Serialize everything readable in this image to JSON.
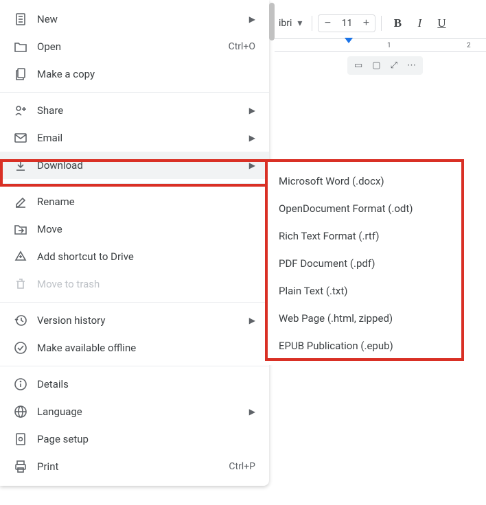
{
  "toolbar": {
    "font_name": "ibri",
    "font_size": "11"
  },
  "ruler": {
    "ticks": [
      "1",
      "2"
    ]
  },
  "menu": {
    "new": "New",
    "open": "Open",
    "open_shortcut": "Ctrl+O",
    "make_copy": "Make a copy",
    "share": "Share",
    "email": "Email",
    "download": "Download",
    "rename": "Rename",
    "move": "Move",
    "add_shortcut": "Add shortcut to Drive",
    "move_trash": "Move to trash",
    "version_history": "Version history",
    "offline": "Make available offline",
    "details": "Details",
    "language": "Language",
    "page_setup": "Page setup",
    "print": "Print",
    "print_shortcut": "Ctrl+P"
  },
  "submenu": {
    "docx": "Microsoft Word (.docx)",
    "odt": "OpenDocument Format (.odt)",
    "rtf": "Rich Text Format (.rtf)",
    "pdf": "PDF Document (.pdf)",
    "txt": "Plain Text (.txt)",
    "html": "Web Page (.html, zipped)",
    "epub": "EPUB Publication (.epub)"
  }
}
